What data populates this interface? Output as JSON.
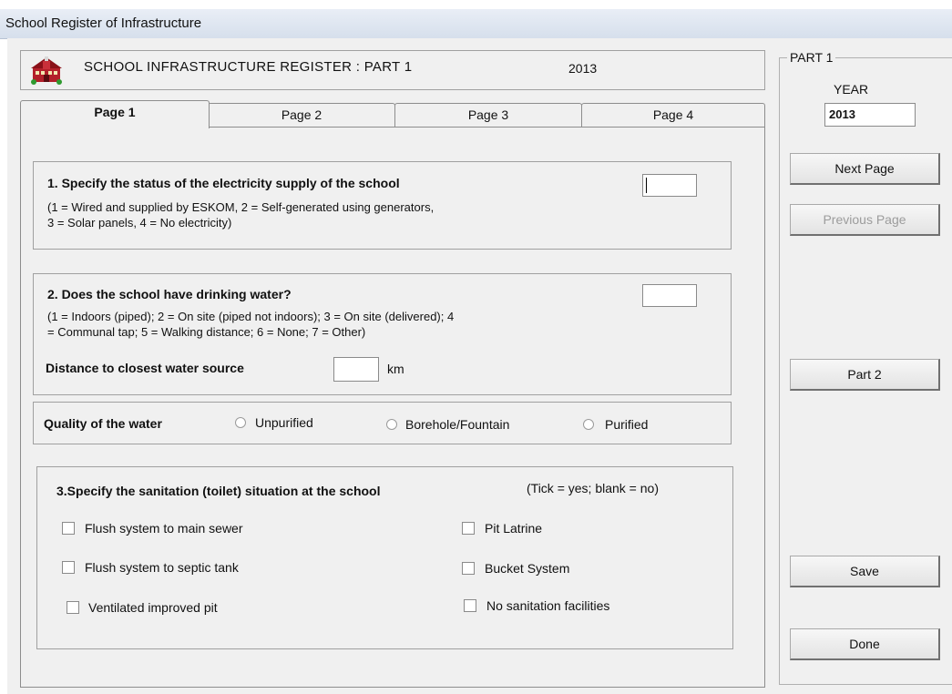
{
  "window": {
    "title": "School Register of Infrastructure"
  },
  "header": {
    "title": "SCHOOL INFRASTRUCTURE REGISTER : PART 1",
    "year": "2013",
    "icon": "school-building-icon"
  },
  "tabs": [
    {
      "label": "Page 1",
      "active": true
    },
    {
      "label": "Page 2",
      "active": false
    },
    {
      "label": "Page 3",
      "active": false
    },
    {
      "label": "Page 4",
      "active": false
    }
  ],
  "q1": {
    "question": "1. Specify the status of the electricity supply of the school",
    "hint_line1": "(1 = Wired and supplied by ESKOM, 2 = Self-generated using generators,",
    "hint_line2": "3 = Solar panels, 4 = No electricity)",
    "value": ""
  },
  "q2": {
    "question": "2. Does the school have drinking water?",
    "hint_line1": "(1 = Indoors (piped);  2 = On site (piped not indoors);  3 = On site (delivered);  4",
    "hint_line2": "= Communal tap;  5 = Walking distance;  6 = None;  7 = Other)",
    "value": "",
    "distance_label": "Distance to closest water source",
    "distance_value": "",
    "distance_unit": "km"
  },
  "quality": {
    "label": "Quality of the water",
    "options": [
      "Unpurified",
      "Borehole/Fountain",
      "Purified"
    ],
    "selected": null
  },
  "q3": {
    "question": "3.Specify the sanitation (toilet) situation at the school",
    "legend": "(Tick = yes; blank = no)",
    "options": [
      "Flush system to main sewer",
      "Flush system to septic tank",
      "Ventilated improved pit",
      "Pit Latrine",
      "Bucket System",
      "No sanitation facilities"
    ]
  },
  "sidebar": {
    "group_label": "PART 1",
    "year_label": "YEAR",
    "year_value": "2013",
    "next_page": "Next Page",
    "previous_page": "Previous Page",
    "part2": "Part 2",
    "save": "Save",
    "done": "Done"
  }
}
